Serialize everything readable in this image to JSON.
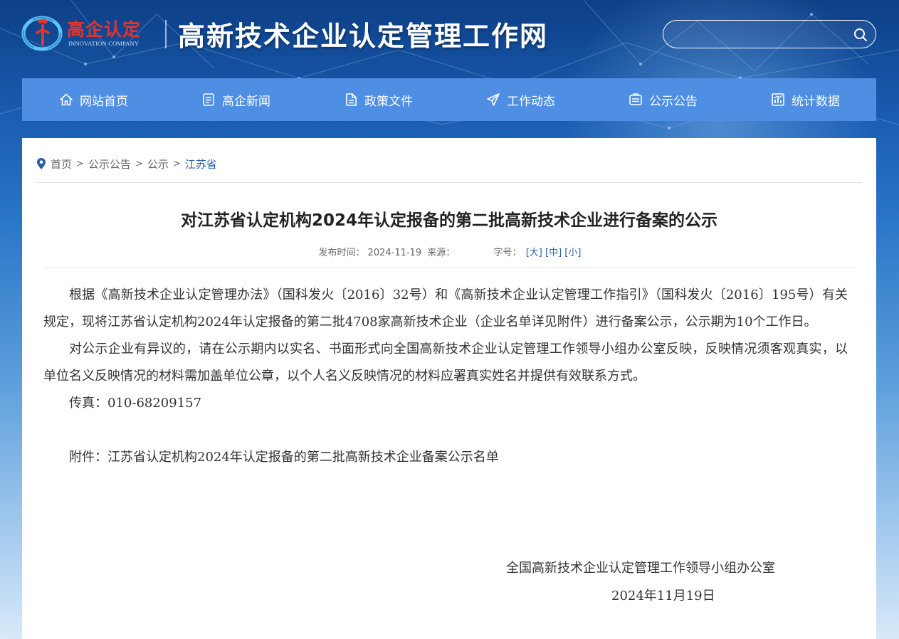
{
  "header": {
    "logo_cn": "高企认定",
    "logo_en": "INNOVATION COMPANY",
    "site_title": "高新技术企业认定管理工作网",
    "search_placeholder": ""
  },
  "nav": [
    {
      "label": "网站首页",
      "icon": "home-icon"
    },
    {
      "label": "高企新闻",
      "icon": "news-icon"
    },
    {
      "label": "政策文件",
      "icon": "document-icon"
    },
    {
      "label": "工作动态",
      "icon": "send-icon"
    },
    {
      "label": "公示公告",
      "icon": "announcement-icon"
    },
    {
      "label": "统计数据",
      "icon": "chart-icon"
    }
  ],
  "breadcrumb": {
    "home": "首页",
    "level1": "公示公告",
    "level2": "公示",
    "current": "江苏省",
    "separator": ">"
  },
  "article": {
    "title": "对江苏省认定机构2024年认定报备的第二批高新技术企业进行备案的公示",
    "meta_date_label": "发布时间：",
    "meta_date": "2024-11-19",
    "meta_source_label": "来源：",
    "meta_fontsize_label": "字号：",
    "font_large": "[大]",
    "font_medium": "[中]",
    "font_small": "[小]",
    "para1": "根据《高新技术企业认定管理办法》（国科发火〔2016〕32号）和《高新技术企业认定管理工作指引》（国科发火〔2016〕195号）有关规定，现将江苏省认定机构2024年认定报备的第二批4708家高新技术企业（企业名单详见附件）进行备案公示，公示期为10个工作日。",
    "para2": "对公示企业有异议的，请在公示期内以实名、书面形式向全国高新技术企业认定管理工作领导小组办公室反映，反映情况须客观真实，以单位名义反映情况的材料需加盖单位公章，以个人名义反映情况的材料应署真实姓名并提供有效联系方式。",
    "fax": "传真：010-68209157",
    "attachment": "附件：江苏省认定机构2024年认定报备的第二批高新技术企业备案公示名单",
    "signature": "全国高新技术企业认定管理工作领导小组办公室",
    "sign_date": "2024年11月19日"
  },
  "colors": {
    "nav_bg": "#4e8ee3",
    "link": "#2a5fa8",
    "logo_red": "#e3342b"
  }
}
